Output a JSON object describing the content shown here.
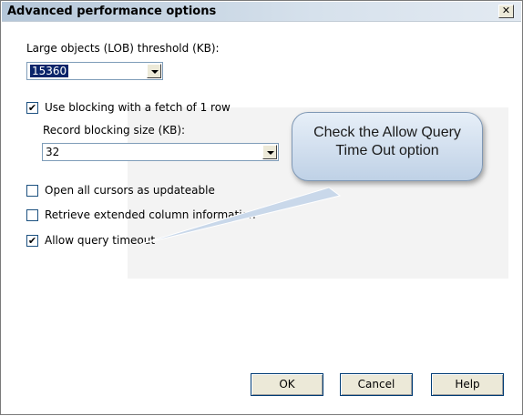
{
  "window": {
    "title": "Advanced performance options",
    "close_glyph": "✕"
  },
  "lob": {
    "label": "Large objects (LOB) threshold (KB):",
    "value": "15360"
  },
  "blocking": {
    "label": "Use blocking with a fetch of 1 row",
    "checked": true,
    "record_label": "Record blocking size (KB):",
    "record_value": "32"
  },
  "options": [
    {
      "label": "Open all cursors as updateable",
      "checked": false
    },
    {
      "label": "Retrieve extended column information",
      "checked": false
    },
    {
      "label": "Allow query timeout",
      "checked": true
    }
  ],
  "callout": {
    "line1": "Check the Allow Query",
    "line2": "Time Out option"
  },
  "buttons": {
    "ok": "OK",
    "cancel": "Cancel",
    "help": "Help"
  },
  "check_glyph": "✔"
}
